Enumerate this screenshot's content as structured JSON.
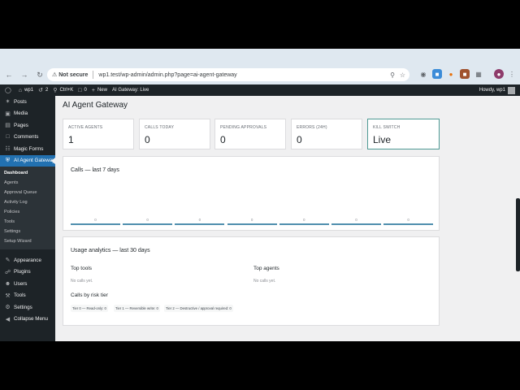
{
  "browser": {
    "security_label": "Not secure",
    "url": "wp1.test/wp-admin/admin.php?page=ai-agent-gateway"
  },
  "adminbar": {
    "site": "wp1",
    "updates": "2",
    "shortcut": "Ctrl+K",
    "comments": "0",
    "new": "New",
    "gateway_status": "AI Gateway: Live",
    "howdy": "Howdy, wp1"
  },
  "sidebar": {
    "items_top": [
      {
        "label": "Posts",
        "icon": "pin-icon"
      },
      {
        "label": "Media",
        "icon": "media-icon"
      },
      {
        "label": "Pages",
        "icon": "page-icon"
      },
      {
        "label": "Comments",
        "icon": "comment-icon"
      },
      {
        "label": "Magic Forms",
        "icon": "form-icon"
      }
    ],
    "active": "AI Agent Gateway",
    "submenu": [
      "Dashboard",
      "Agents",
      "Approval Queue",
      "Activity Log",
      "Policies",
      "Tools",
      "Settings",
      "Setup Wizard"
    ],
    "items_bottom": [
      {
        "label": "Appearance",
        "icon": "brush-icon"
      },
      {
        "label": "Plugins",
        "icon": "plugin-icon"
      },
      {
        "label": "Users",
        "icon": "user-icon"
      },
      {
        "label": "Tools",
        "icon": "wrench-icon"
      },
      {
        "label": "Settings",
        "icon": "settings-icon"
      },
      {
        "label": "Collapse Menu",
        "icon": "collapse-icon"
      }
    ]
  },
  "page": {
    "title": "AI Agent Gateway",
    "stats": [
      {
        "label": "ACTIVE AGENTS",
        "value": "1"
      },
      {
        "label": "CALLS TODAY",
        "value": "0"
      },
      {
        "label": "PENDING APPROVALS",
        "value": "0"
      },
      {
        "label": "ERRORS (24H)",
        "value": "0"
      },
      {
        "label": "KILL SWITCH",
        "value": "Live"
      }
    ],
    "calls_card": {
      "title": "Calls — last 7 days",
      "values": [
        "0",
        "0",
        "0",
        "0",
        "0",
        "0",
        "0"
      ]
    },
    "usage_card": {
      "title": "Usage analytics — last 30 days",
      "top_tools": "Top tools",
      "top_tools_empty": "No calls yet.",
      "top_agents": "Top agents",
      "top_agents_empty": "No calls yet.",
      "risk_title": "Calls by risk tier",
      "tiers": [
        "Tier 0 — Read-only: 0",
        "Tier 1 — Reversible write: 0",
        "Tier 2 — Destructive / approval required: 0"
      ]
    }
  }
}
